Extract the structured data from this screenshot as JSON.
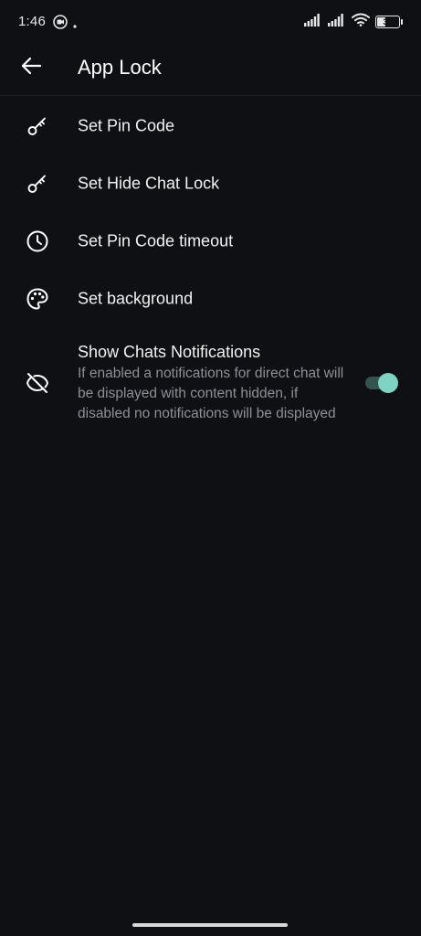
{
  "status_bar": {
    "time": "1:46",
    "battery_level": "35",
    "battery_fraction": 0.35,
    "icons": [
      "screen-record-icon",
      "dot-icon",
      "signal-icon",
      "signal-icon",
      "wifi-icon",
      "battery-icon"
    ]
  },
  "app_bar": {
    "title": "App Lock",
    "back_icon": "arrow-left-icon"
  },
  "settings": [
    {
      "label": "Set Pin Code",
      "icon": "key-icon"
    },
    {
      "label": "Set Hide Chat Lock",
      "icon": "key-icon"
    },
    {
      "label": "Set Pin Code timeout",
      "icon": "clock-icon"
    },
    {
      "label": "Set background",
      "icon": "palette-icon"
    }
  ],
  "notifications_setting": {
    "title": "Show Chats Notifications",
    "description": "If enabled a notifications for direct chat will be displayed with content hidden, if disabled no notifications will be displayed",
    "icon": "eye-off-icon",
    "enabled": true
  },
  "colors": {
    "background": "#0e1014",
    "toggle_track": "#34544f",
    "toggle_thumb": "#7fd3c2",
    "secondary_text": "#8d9096"
  }
}
